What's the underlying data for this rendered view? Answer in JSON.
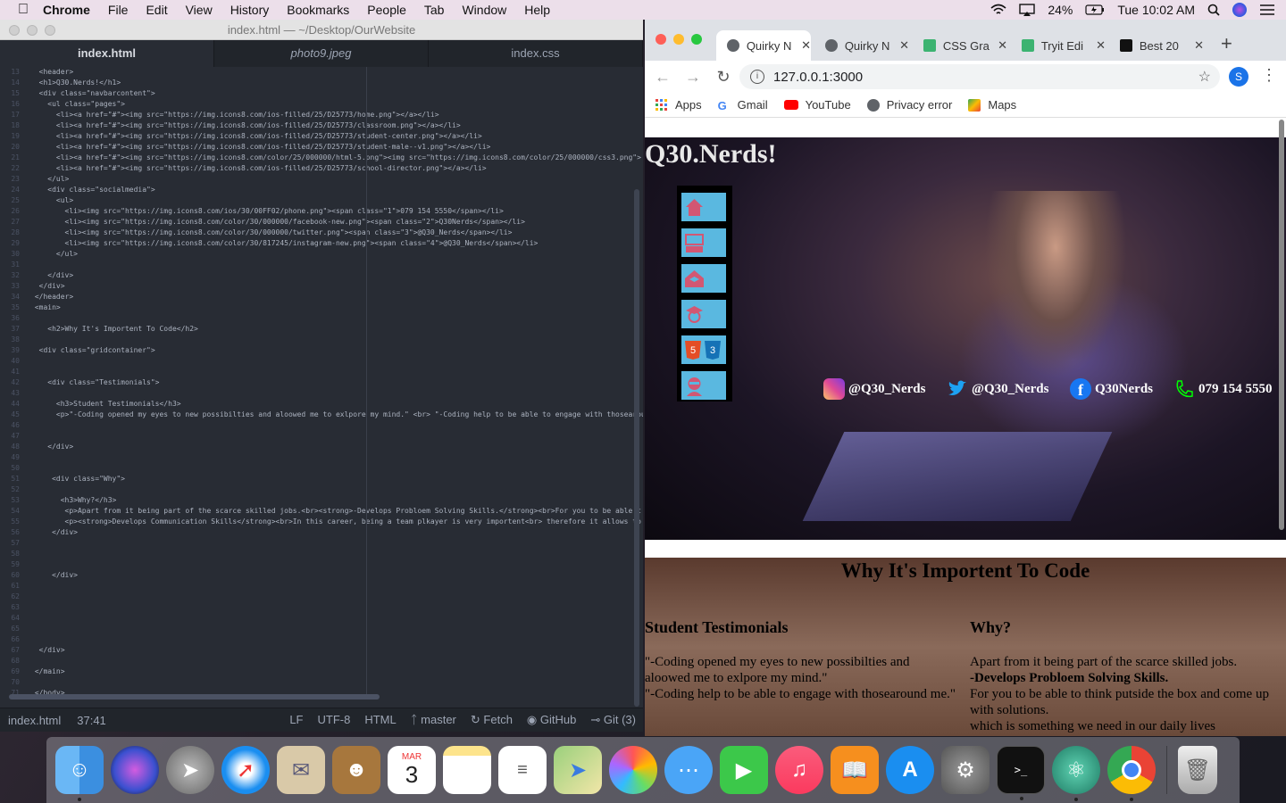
{
  "menubar": {
    "app": "Chrome",
    "items": [
      "File",
      "Edit",
      "View",
      "History",
      "Bookmarks",
      "People",
      "Tab",
      "Window",
      "Help"
    ],
    "battery": "24%",
    "clock": "Tue 10:02 AM"
  },
  "editor": {
    "title": "index.html — ~/Desktop/OurWebsite",
    "tabs": [
      "index.html",
      "photo9.jpeg",
      "index.css"
    ],
    "line_numbers": [
      "13",
      "14",
      "15",
      "16",
      "17",
      "18",
      "19",
      "20",
      "21",
      "22",
      "23",
      "24",
      "25",
      "26",
      "27",
      "28",
      "29",
      "30",
      "31",
      "32",
      "33",
      "34",
      "35",
      "36",
      "37",
      "38",
      "39",
      "40",
      "41",
      "42",
      "43",
      "44",
      "45",
      "46",
      "47",
      "48",
      "49",
      "50",
      "51",
      "52",
      "53",
      "54",
      "55",
      "56",
      "57",
      "58",
      "59",
      "60",
      "61",
      "62",
      "63",
      "64",
      "65",
      "66",
      "67",
      "68",
      "69",
      "70",
      "71"
    ],
    "lines": [
      "  <header>",
      "  <h1>Q30.Nerds!</h1>",
      "  <div class=\"navbarcontent\">",
      "    <ul class=\"pages\">",
      "      <li><a href=\"#\"><img src=\"https://img.icons8.com/ios-filled/25/D25773/home.png\"></a></li>",
      "      <li><a href=\"#\"><img src=\"https://img.icons8.com/ios-filled/25/D25773/classroom.png\"></a></li>",
      "      <li><a href=\"#\"><img src=\"https://img.icons8.com/ios-filled/25/D25773/student-center.png\"></a></li>",
      "      <li><a href=\"#\"><img src=\"https://img.icons8.com/ios-filled/25/D25773/student-male--v1.png\"></a></li>",
      "      <li><a href=\"#\"><img src=\"https://img.icons8.com/color/25/000000/html-5.png\"><img src=\"https://img.icons8.com/color/25/000000/css3.png\">",
      "      <li><a href=\"#\"><img src=\"https://img.icons8.com/ios-filled/25/D25773/school-director.png\"></a></li>",
      "    </ul>",
      "    <div class=\"socialmedia\">",
      "      <ul>",
      "        <li><img src=\"https://img.icons8.com/ios/30/00FF02/phone.png\"><span class=\"1\">079 154 5550</span></li>",
      "        <li><img src=\"https://img.icons8.com/color/30/000000/facebook-new.png\"><span class=\"2\">Q30Nerds</span></li>",
      "        <li><img src=\"https://img.icons8.com/color/30/000000/twitter.png\"><span class=\"3\">@Q30_Nerds</span></li>",
      "        <li><img src=\"https://img.icons8.com/color/30/817245/instagram-new.png\"><span class=\"4\">@Q30_Nerds</span></li>",
      "      </ul>",
      "",
      "    </div>",
      "  </div>",
      " </header>",
      " <main>",
      "",
      "    <h2>Why It's Importent To Code</h2>",
      "",
      "  <div class=\"gridcontainer\">",
      "",
      "",
      "    <div class=\"Testimonials\">",
      "",
      "      <h3>Student Testimonials</h3>",
      "      <p>\"-Coding opened my eyes to new possibilties and aloowed me to exlpore my mind.\" <br> \"-Coding help to be able to engage with thosearou",
      "",
      "",
      "    </div>",
      "",
      "",
      "     <div class=\"Why\">",
      "",
      "       <h3>Why?</h3>",
      "        <p>Apart from it being part of the scarce skilled jobs.<br><strong>-Develops Probloem Solving Skills.</strong><br>For you to be able t",
      "        <p><strong>Develops Communication Skills</strong><br>In this career, being a team plkayer is very importent<br> therefore it allows to",
      "     </div>",
      "",
      "",
      "",
      "     </div>",
      "",
      "",
      "",
      "",
      "",
      "",
      "  </div>",
      "",
      " </main>",
      "",
      " </body>"
    ],
    "status": {
      "file": "index.html",
      "cursor": "37:41",
      "eol": "LF",
      "encoding": "UTF-8",
      "grammar": "HTML",
      "branch": "master",
      "fetch": "Fetch",
      "github": "GitHub",
      "git": "Git (3)"
    }
  },
  "browser": {
    "tabs": [
      {
        "label": "Quirky N",
        "color": "#5f6368"
      },
      {
        "label": "Quirky N",
        "color": "#5f6368"
      },
      {
        "label": "CSS Gra",
        "color": "#3cb371"
      },
      {
        "label": "Tryit Edi",
        "color": "#3cb371"
      },
      {
        "label": "Best 20",
        "color": "#111111"
      }
    ],
    "url": "127.0.0.1:3000",
    "profile_initial": "S",
    "bookmarks": [
      "Apps",
      "Gmail",
      "YouTube",
      "Privacy error",
      "Maps"
    ]
  },
  "site": {
    "title": "Q30.Nerds!",
    "social": [
      {
        "icon": "instagram-icon",
        "text": "@Q30_Nerds"
      },
      {
        "icon": "twitter-icon",
        "text": "@Q30_Nerds"
      },
      {
        "icon": "facebook-icon",
        "text": "Q30Nerds"
      },
      {
        "icon": "phone-icon",
        "text": "079 154 5550"
      }
    ],
    "why_heading": "Why It's Importent To Code",
    "testimonials_heading": "Student Testimonials",
    "testimonials_text": "\"-Coding opened my eyes to new possibilties and aloowed me to exlpore my mind.\"\n\"-Coding help to be able to engage with thosearound me.\"",
    "why_sub": "Why?",
    "why_line1": "Apart from it being part of the scarce skilled jobs.",
    "why_strong": "-Develops Probloem Solving Skills.",
    "why_line2": "For you to be able to think putside the box and come up with solutions.",
    "why_line3": "which is something we need in our daily lives"
  },
  "dock": {
    "apps": [
      "Finder",
      "Siri",
      "Launchpad",
      "Safari",
      "Mail",
      "Contacts",
      "Calendar",
      "Notes",
      "Reminders",
      "Maps",
      "Photos",
      "Messages",
      "FaceTime",
      "iTunes",
      "iBooks",
      "App Store",
      "System Preferences",
      "Terminal",
      "Atom",
      "Chrome",
      "Trash"
    ],
    "calendar_month": "MAR",
    "calendar_day": "3"
  }
}
